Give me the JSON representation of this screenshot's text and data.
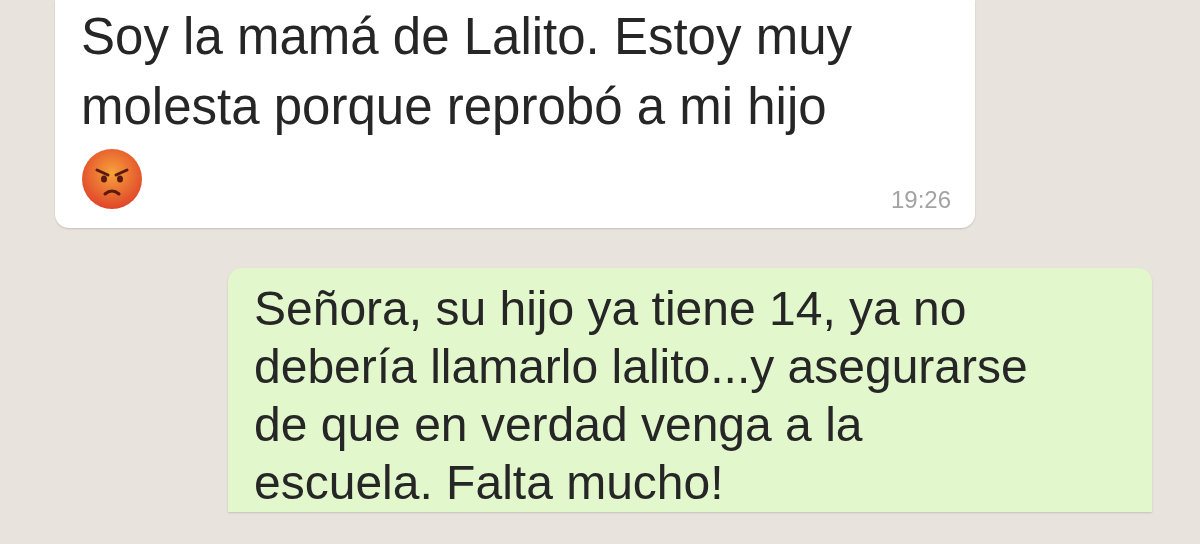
{
  "messages": [
    {
      "kind": "incoming",
      "lines": [
        "Soy la mamá de Lalito. Estoy muy",
        "molesta porque reprobó a mi hijo"
      ],
      "emoji": true,
      "time": "19:26"
    },
    {
      "kind": "outgoing",
      "lines": [
        "Señora, su hijo ya tiene 14, ya no",
        "debería llamarlo lalito...y asegurarse",
        "de que en verdad venga a la",
        "escuela. Falta mucho!"
      ],
      "emoji": false
    }
  ]
}
